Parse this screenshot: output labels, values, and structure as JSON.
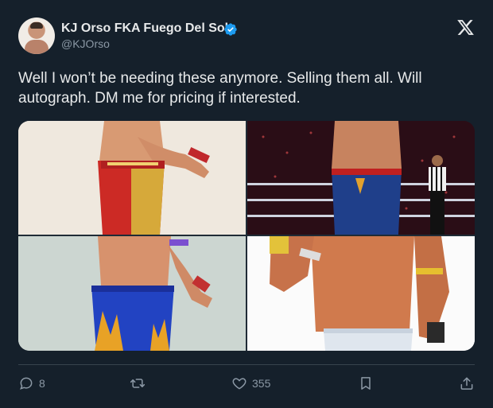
{
  "author": {
    "name": "KJ Orso FKA Fuego Del Sol",
    "handle": "@KJOrso",
    "verified": true,
    "verified_color": "#1d9bf0"
  },
  "tweet": {
    "text": "Well I won’t be needing these anymore. Selling them all. Will autograph. DM me for pricing if interested."
  },
  "media": {
    "count": 4,
    "icons": [
      "wrestler-gear-photo",
      "wrestler-gear-photo",
      "wrestler-gear-photo",
      "wrestler-gear-photo"
    ]
  },
  "actions": {
    "reply_count": "8",
    "retweet_count": "",
    "like_count": "355"
  },
  "colors": {
    "background": "#15202b",
    "text": "#e7e9ea",
    "secondary": "#8b98a5",
    "divider": "#38444d"
  }
}
